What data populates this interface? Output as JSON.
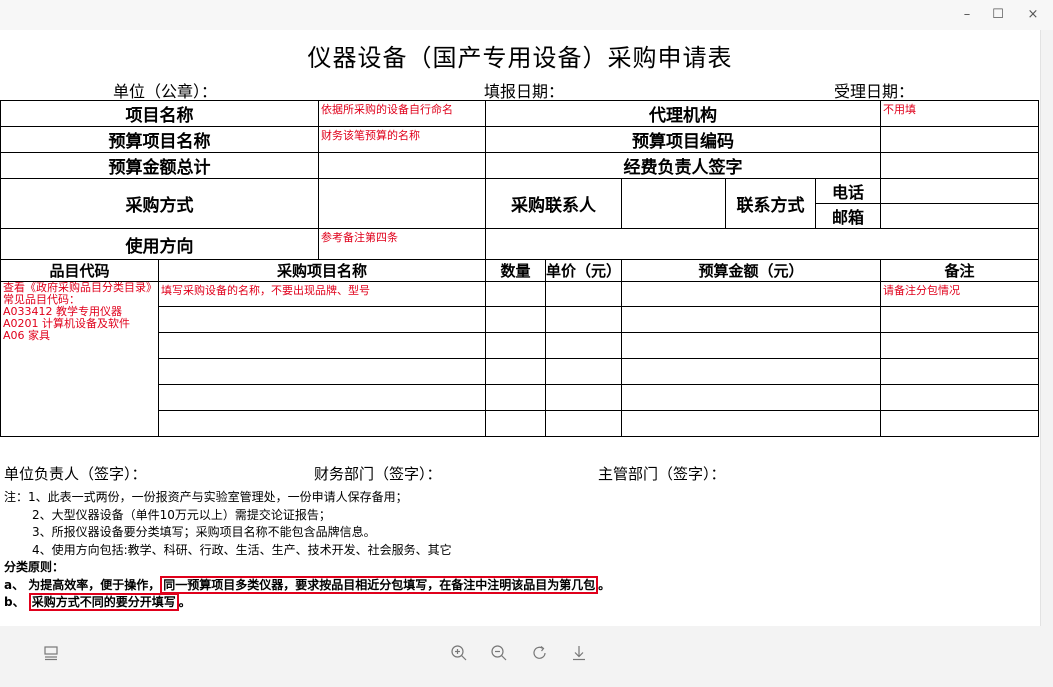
{
  "window": {
    "minimize_glyph": "–",
    "maximize_glyph": "☐",
    "close_glyph": "×"
  },
  "form": {
    "title": "仪器设备（国产专用设备）采购申请表",
    "unit_label": "单位（公章）：",
    "fill_date_label": "填报日期：",
    "accept_date_label": "受理日期：",
    "project_name_label": "项目名称",
    "project_name_hint": "依据所采购的设备自行命名",
    "agency_label": "代理机构",
    "agency_hint": "不用填",
    "budget_item_label": "预算项目名称",
    "budget_item_hint": "财务该笔预算的名称",
    "budget_code_label": "预算项目编码",
    "budget_total_label": "预算金额总计",
    "fund_signer_label": "经费负责人签字",
    "procure_method_label": "采购方式",
    "procure_contact_label": "采购联系人",
    "contact_method_label": "联系方式",
    "phone_label": "电话",
    "email_label": "邮箱",
    "usage_label": "使用方向",
    "usage_hint": "参考备注第四条",
    "columns": [
      "品目代码",
      "采购项目名称",
      "数量",
      "单价（元）",
      "预算金额（元）",
      "备注"
    ],
    "item_code_hint": "查看《政府采购品目分类目录》",
    "common_codes_label": "常见品目代码：",
    "common_codes": [
      "A033412 教学专用仪器",
      "A0201 计算机设备及软件",
      "A06 家具"
    ],
    "item_name_hint": "填写采购设备的名称，不要出现品牌、型号",
    "remark_hint": "请备注分包情况",
    "sign_unit": "单位负责人（签字）：",
    "sign_finance": "财务部门（签字）：",
    "sign_dept": "主管部门（签字）：",
    "notes": [
      "注：1、此表一式两份，一份报资产与实验室管理处，一份申请人保存备用；",
      "2、大型仪器设备（单件10万元以上）需提交论证报告；",
      "3、所报仪器设备要分类填写；采购项目名称不能包含品牌信息。",
      "4、使用方向包括:教学、科研、行政、生活、生产、技术开发、社会服务、其它"
    ],
    "principle_title": "分类原则：",
    "principle_a_prefix": "a、 为提高效率，便于操作，",
    "principle_a_boxed": "同一预算项目多类仪器，要求按品目相近分包填写，在备注中注明该品目为第几包",
    "principle_a_suffix": "。",
    "principle_b_prefix": "b、 ",
    "principle_b_boxed": "采购方式不同的要分开填写",
    "principle_b_suffix": "。"
  },
  "viewer_toolbar": {
    "layout_icon": "layout-icon",
    "zoom_in_icon": "zoom-in-icon",
    "zoom_out_icon": "zoom-out-icon",
    "rotate_icon": "rotate-icon",
    "download_icon": "download-icon"
  },
  "colors": {
    "hint_red": "#e0001b",
    "bottom_bar": "#f3f3f3"
  }
}
